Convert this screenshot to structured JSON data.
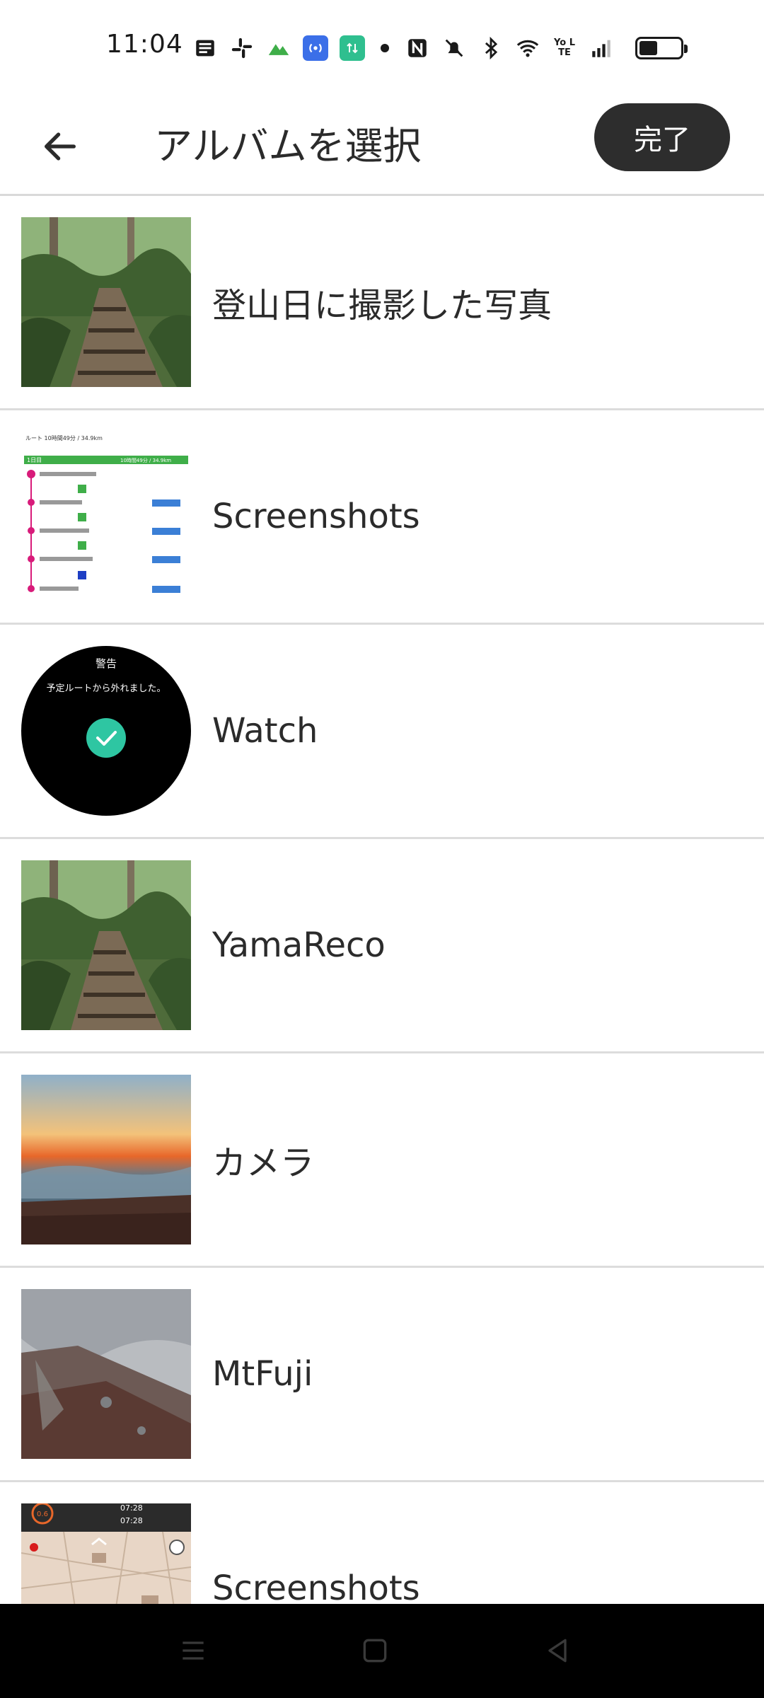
{
  "status_bar": {
    "time": "11:04",
    "icons": [
      "news-icon",
      "slack-icon",
      "mountain-icon",
      "broadcast-icon",
      "data-sync-icon",
      "dot-icon",
      "nfc-icon",
      "mute-icon",
      "bluetooth-icon",
      "wifi-icon",
      "volte-icon",
      "signal-icon",
      "battery-icon"
    ],
    "network_label": "Yo LTE",
    "battery_level": 0.45
  },
  "app_bar": {
    "title": "アルバムを選択",
    "done_label": "完了",
    "back_icon": "arrow-left-icon"
  },
  "albums": [
    {
      "name": "登山日に撮影した写真",
      "thumb": "forest-trail"
    },
    {
      "name": "Screenshots",
      "thumb": "route-screenshot"
    },
    {
      "name": "Watch",
      "thumb": "watch-alert"
    },
    {
      "name": "YamaReco",
      "thumb": "forest-trail"
    },
    {
      "name": "カメラ",
      "thumb": "sunrise-clouds"
    },
    {
      "name": "MtFuji",
      "thumb": "foggy-slope"
    },
    {
      "name": "Screenshots",
      "thumb": "map-screenshot"
    }
  ],
  "thumb_text": {
    "route": {
      "header": "ルート 10時間49分 / 34.9km",
      "day": "1日目",
      "day_total": "10時間49分 / 34.9km"
    },
    "watch": {
      "title": "警告",
      "message": "予定ルートから外れました。"
    },
    "map": {
      "time1": "07:28",
      "time2": "07:28",
      "badge": "0.6"
    }
  },
  "colors": {
    "done_button_bg": "#2d2d2d",
    "divider": "#dcdcdc",
    "nav_bar": "#000000",
    "watch_check": "#2ec6a2"
  }
}
